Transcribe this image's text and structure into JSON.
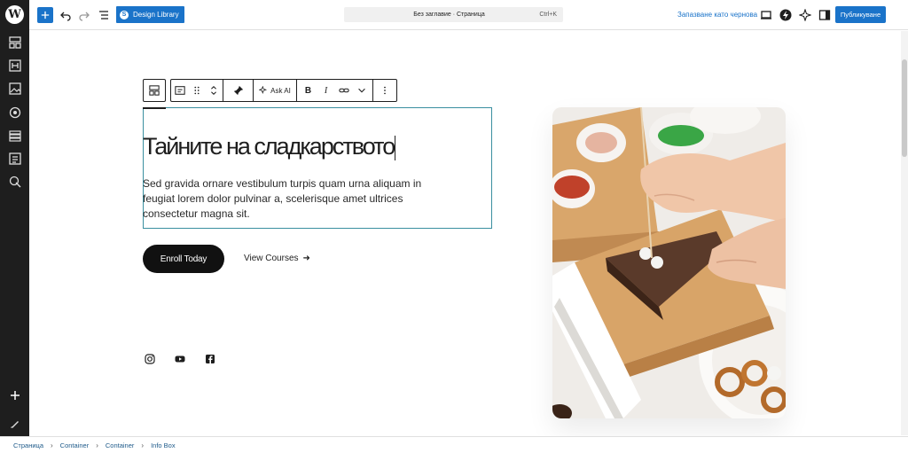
{
  "topbar": {
    "design_library_label": "Design Library",
    "design_library_badge": "S",
    "document_title": "Без заглавие · Страница",
    "shortcut": "Ctrl+K",
    "save_draft_label": "Запазване като чернова",
    "publish_label": "Публикуване"
  },
  "block_toolbar": {
    "ask_ai_label": "Ask AI",
    "bold_label": "B",
    "italic_label": "I"
  },
  "content": {
    "heading": "Тайните на сладкарството",
    "paragraph": "Sed gravida ornare vestibulum turpis quam urna aliquam in feugiat lorem dolor pulvinar a, scelerisque amet ultrices consectetur magna sit.",
    "primary_button": "Enroll Today",
    "secondary_link": "View Courses",
    "secondary_arrow": "➜"
  },
  "breadcrumb": {
    "items": [
      "Страница",
      "Container",
      "Container",
      "Info Box"
    ],
    "separator": "›"
  },
  "icons": {
    "logo": "wordpress-logo",
    "social": [
      "instagram-icon",
      "youtube-icon",
      "facebook-icon"
    ]
  },
  "colors": {
    "accent": "#1a73c9",
    "sidebar": "#1e1e1e",
    "selection": "#3a8fa0",
    "button_dark": "#111111"
  }
}
